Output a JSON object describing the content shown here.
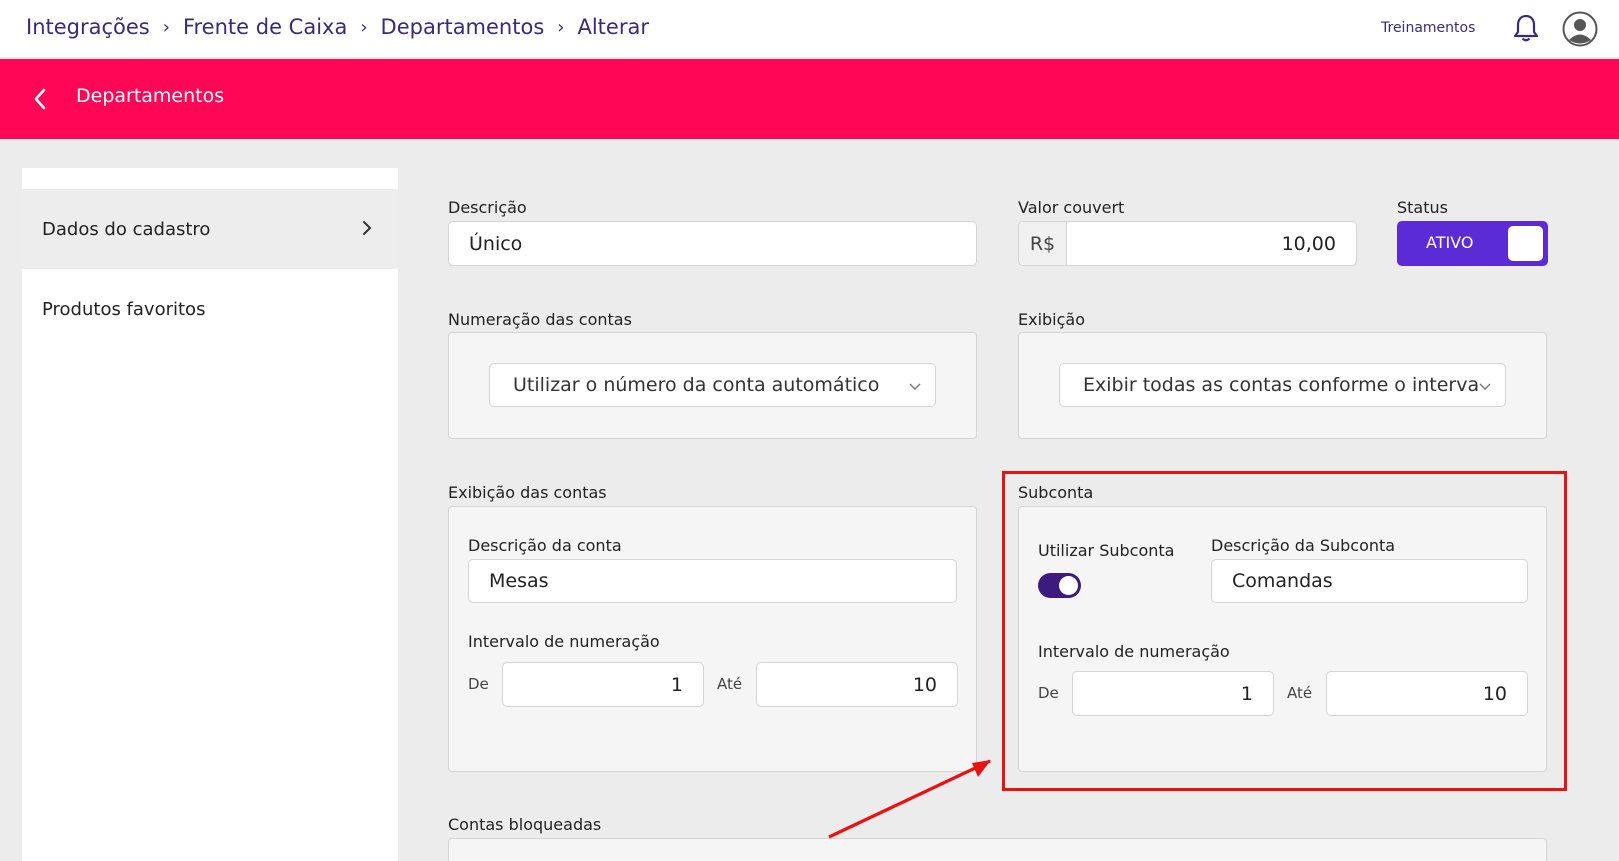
{
  "breadcrumb": {
    "items": [
      "Integrações",
      "Frente de Caixa",
      "Departamentos",
      "Alterar"
    ]
  },
  "header": {
    "training_link": "Treinamentos"
  },
  "page": {
    "title": "Departamentos"
  },
  "sidebar": {
    "items": [
      {
        "label": "Dados do cadastro",
        "active": true
      },
      {
        "label": "Produtos favoritos",
        "active": false
      }
    ]
  },
  "form": {
    "descricao_label": "Descrição",
    "descricao_value": "Único",
    "valor_couvert_label": "Valor couvert",
    "valor_couvert_prefix": "R$",
    "valor_couvert_value": "10,00",
    "status_label": "Status",
    "status_value": "ATIVO",
    "numeracao_label": "Numeração das contas",
    "numeracao_value": "Utilizar o número da conta automático",
    "exibicao_label": "Exibição",
    "exibicao_value": "Exibir todas as contas conforme o interva",
    "exibicao_contas_label": "Exibição das contas",
    "descricao_conta_label": "Descrição da conta",
    "descricao_conta_value": "Mesas",
    "intervalo_label": "Intervalo de numeração",
    "de_label": "De",
    "de_value": "1",
    "ate_label": "Até",
    "ate_value": "10",
    "subconta_label": "Subconta",
    "utilizar_subconta_label": "Utilizar Subconta",
    "utilizar_subconta_on": true,
    "descricao_subconta_label": "Descrição da Subconta",
    "descricao_subconta_value": "Comandas",
    "sub_intervalo_label": "Intervalo de numeração",
    "sub_de_label": "De",
    "sub_de_value": "1",
    "sub_ate_label": "Até",
    "sub_ate_value": "10",
    "contas_bloqueadas_label": "Contas bloqueadas"
  },
  "colors": {
    "accent_pink": "#ff0656",
    "primary_purple": "#5b2bd6",
    "toggle_purple": "#3c1a7e",
    "highlight_red": "#ea1111",
    "breadcrumb_text": "#3b2a7a"
  }
}
